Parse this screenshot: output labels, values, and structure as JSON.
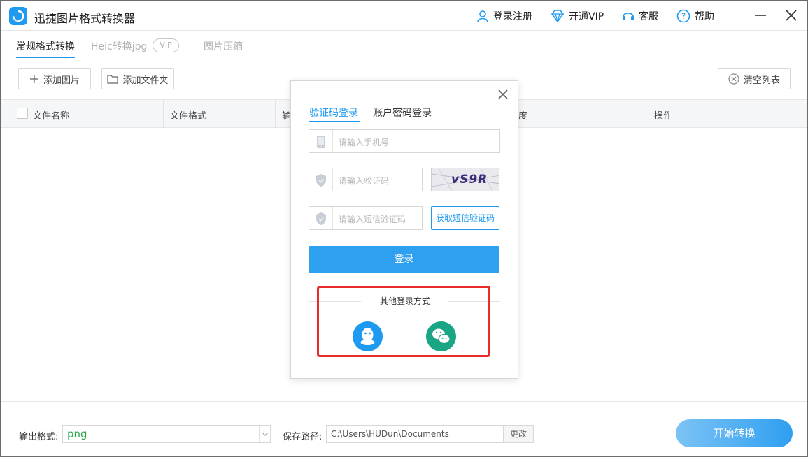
{
  "app": {
    "title": "迅捷图片格式转换器",
    "accent_color": "#1e9bf0"
  },
  "topnav": {
    "login_register": "登录注册",
    "vip": "开通VIP",
    "service": "客服",
    "help": "帮助"
  },
  "tabs": [
    {
      "label": "常规格式转换",
      "active": true
    },
    {
      "label": "Heic转换jpg",
      "badge": "VIP",
      "active": false
    },
    {
      "label": "图片压缩",
      "active": false
    }
  ],
  "toolbar": {
    "add_image": "添加图片",
    "add_folder": "添加文件夹",
    "clear_list": "清空列表"
  },
  "table": {
    "columns": [
      "文件名称",
      "文件格式",
      "输",
      "度",
      "操作"
    ]
  },
  "bottom": {
    "output_format_label": "输出格式:",
    "output_format_value": "png",
    "save_path_label": "保存路径:",
    "save_path_value": "C:\\Users\\HUDun\\Documents",
    "change_label": "更改",
    "start_label": "开始转换"
  },
  "login_dialog": {
    "tab_sms": "验证码登录",
    "tab_password": "账户密码登录",
    "phone_placeholder": "请输入手机号",
    "captcha_placeholder": "请输入验证码",
    "captcha_text": "vS9R",
    "sms_placeholder": "请输入短信验证码",
    "get_sms_label": "获取短信验证码",
    "login_label": "登录",
    "other_methods_label": "其他登录方式",
    "qq_color": "#1e9bf0",
    "wechat_color": "#1aa584"
  }
}
